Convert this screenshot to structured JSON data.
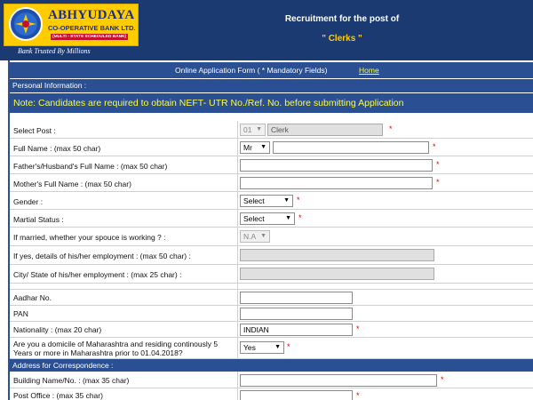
{
  "header": {
    "bank_name": "ABHYUDAYA",
    "bank_sub": "CO-OPERATIVE BANK LTD.",
    "bank_tag": "(MULTI - STATE SCHEDULED BANK)",
    "tagline": "Bank Trusted By Millions",
    "recruitment_title": "Recruitment for the post of",
    "post": "\" Clerks \""
  },
  "topbar": {
    "title": "Online Application Form ( * Mandatory Fields)",
    "home_link": "Home"
  },
  "personal_section": {
    "heading": "Personal Information :",
    "note": "Note: Candidates are required to obtain NEFT- UTR No./Ref. No. before submitting Application"
  },
  "fields": {
    "select_post": {
      "label": "Select Post :",
      "code": "01",
      "value": "Clerk"
    },
    "full_name": {
      "label": "Full Name : (max 50 char)",
      "title_value": "Mr",
      "value": ""
    },
    "father_name": {
      "label": "Father's/Husband's Full Name : (max 50 char)",
      "value": ""
    },
    "mother_name": {
      "label": "Mother's Full Name : (max 50 char)",
      "value": ""
    },
    "gender": {
      "label": "Gender :",
      "value": "Select"
    },
    "marital_status": {
      "label": "Martial Status :",
      "value": "Select"
    },
    "spouse_working": {
      "label": "If married, whether your spouce is working ? :",
      "value": "N.A"
    },
    "employment_details": {
      "label": "If yes, details of his/her employment : (max 50 char) :",
      "value": ""
    },
    "employment_city": {
      "label": "City/ State of his/her employment : (max 25 char) :",
      "value": ""
    },
    "aadhar": {
      "label": "Aadhar No.",
      "value": ""
    },
    "pan": {
      "label": "PAN",
      "value": ""
    },
    "nationality": {
      "label": "Nationality : (max 20 char)",
      "value": "INDIAN"
    },
    "domicile": {
      "label": "Are you a domicile of Maharashtra and residing continously 5 Years or more in Maharashtra prior to 01.04.2018?",
      "value": "Yes"
    },
    "building": {
      "label": "Building Name/No. : (max 35 char)",
      "value": ""
    },
    "post_office": {
      "label": "Post Office : (max 35 char)",
      "value": ""
    }
  },
  "address_section": {
    "heading": "Address for Correspondence :"
  },
  "mandatory_mark": "*",
  "colors": {
    "header_bg": "#1c3a72",
    "form_bar": "#2a4f92",
    "logo_yellow": "#ffcc00",
    "note_yellow": "#ffff33",
    "required_red": "#e00000"
  }
}
